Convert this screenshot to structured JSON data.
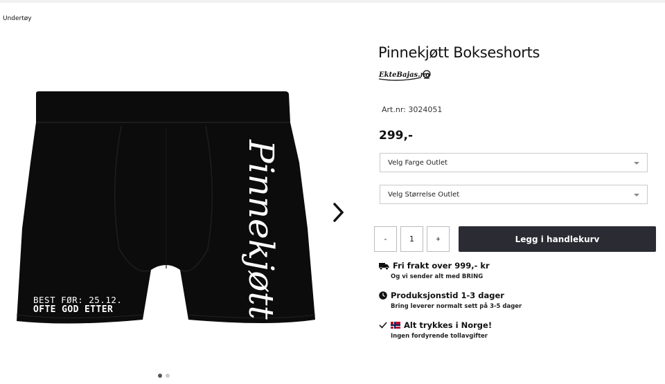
{
  "breadcrumb": "Undertøy",
  "product": {
    "title": "Pinnekjøtt Bokseshorts",
    "brand": "EkteBajas.no",
    "art_nr": "Art.nr: 3024051",
    "price": "299,-",
    "print_text": "Pinnekjøtt",
    "label_line1": "BEST FØR: 25.12.",
    "label_line2": "OFTE GOD ETTER"
  },
  "options": {
    "color_select": "Velg Farge Outlet",
    "size_select": "Velg Størrelse Outlet"
  },
  "quantity": {
    "minus": "-",
    "value": "1",
    "plus": "+"
  },
  "cart_button": "Legg i handlekurv",
  "features": [
    {
      "icon": "truck-icon",
      "title": "Fri frakt over 999,- kr",
      "sub": "Og vi sender alt med BRING"
    },
    {
      "icon": "clock-icon",
      "title": "Produksjonstid 1-3 dager",
      "sub": "Bring leverer normalt sett på 3-5 dager"
    },
    {
      "icon": "check-icon",
      "title": "Alt trykkes i Norge!",
      "sub": "Ingen fordyrende tollavgifter"
    }
  ],
  "gallery": {
    "slides": 2,
    "active": 1
  },
  "colors": {
    "button_bg": "#2b2b33",
    "garment": "#0c0c0c",
    "flag_red": "#ba0c2f",
    "flag_blue": "#00205b"
  }
}
